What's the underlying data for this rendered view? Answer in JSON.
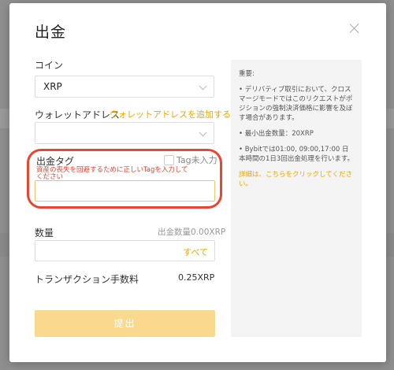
{
  "modal": {
    "title": "出金"
  },
  "coin": {
    "label": "コイン",
    "value": "XRP"
  },
  "wallet": {
    "label": "ウォレットアドレス",
    "add_link": "ウォレットアドレスを追加する",
    "value": ""
  },
  "tag": {
    "label": "出金タグ",
    "checkbox_label": "Tag未入力",
    "warning": "資産の喪失を回避するために正しいTagを入力してください",
    "value": ""
  },
  "amount": {
    "label": "数量",
    "withdraw_amount": "出金数量0.00XRP",
    "max_button": "すべて",
    "value": ""
  },
  "fee": {
    "label": "トランザクション手数料",
    "value": "0.25XRP"
  },
  "submit_label": "提出",
  "info": {
    "heading": "重要:",
    "items": [
      "• デリバティブ取引において、クロスマージモードではこのリクエストがポジションの強制決済価格に影響を及ぼす場合があります。",
      "• 最小出金数量：20XRP",
      "• Bybitでは01:00, 09:00,17:00 日本時間の1日3回出金処理を行います。"
    ],
    "more_link": "詳細は、こちらをクリックしてください。"
  },
  "colors": {
    "accent": "#f0a500",
    "warning": "#e8402c",
    "highlight": "#e8462f",
    "submit_bg": "#f8d98e"
  }
}
